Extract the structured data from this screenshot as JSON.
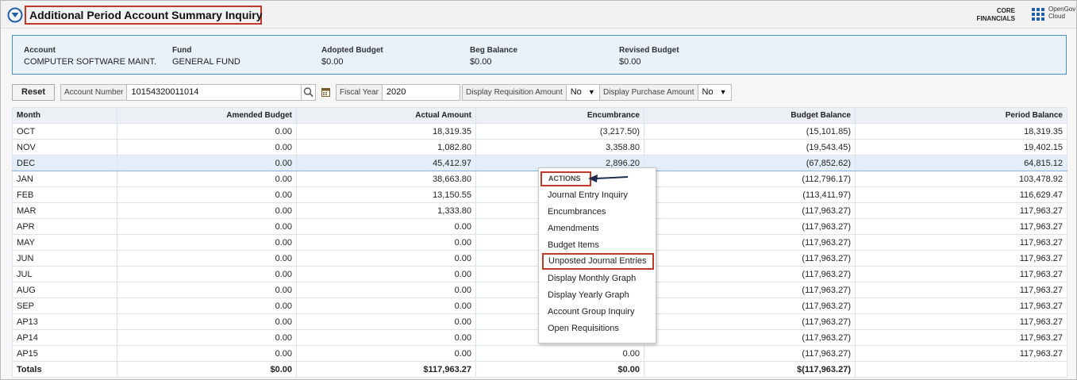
{
  "header": {
    "title": "Additional Period Account Summary Inquiry",
    "core_line1": "CORE",
    "core_line2": "FINANCIALS",
    "og_line1": "OpenGov",
    "og_line2": "Cloud"
  },
  "summary": {
    "account": {
      "label": "Account",
      "value": "COMPUTER SOFTWARE MAINT."
    },
    "fund": {
      "label": "Fund",
      "value": "GENERAL FUND"
    },
    "adopted": {
      "label": "Adopted Budget",
      "value": "$0.00"
    },
    "beg": {
      "label": "Beg Balance",
      "value": "$0.00"
    },
    "revised": {
      "label": "Revised Budget",
      "value": "$0.00"
    }
  },
  "filters": {
    "reset_label": "Reset",
    "account_number_label": "Account Number",
    "account_number_value": "10154320011014",
    "fiscal_year_label": "Fiscal Year",
    "fiscal_year_value": "2020",
    "req_label": "Display Requisition Amount",
    "req_value": "No",
    "po_label": "Display Purchase Amount",
    "po_value": "No"
  },
  "table": {
    "headers": [
      "Month",
      "Amended Budget",
      "Actual Amount",
      "Encumbrance",
      "Budget Balance",
      "Period Balance"
    ],
    "rows": [
      [
        "OCT",
        "0.00",
        "18,319.35",
        "(3,217.50)",
        "(15,101.85)",
        "18,319.35"
      ],
      [
        "NOV",
        "0.00",
        "1,082.80",
        "3,358.80",
        "(19,543.45)",
        "19,402.15"
      ],
      [
        "DEC",
        "0.00",
        "45,412.97",
        "2,896.20",
        "(67,852.62)",
        "64,815.12"
      ],
      [
        "JAN",
        "0.00",
        "38,663.80",
        "",
        "(112,796.17)",
        "103,478.92"
      ],
      [
        "FEB",
        "0.00",
        "13,150.55",
        "",
        "(113,411.97)",
        "116,629.47"
      ],
      [
        "MAR",
        "0.00",
        "1,333.80",
        "",
        "(117,963.27)",
        "117,963.27"
      ],
      [
        "APR",
        "0.00",
        "0.00",
        "",
        "(117,963.27)",
        "117,963.27"
      ],
      [
        "MAY",
        "0.00",
        "0.00",
        "",
        "(117,963.27)",
        "117,963.27"
      ],
      [
        "JUN",
        "0.00",
        "0.00",
        "",
        "(117,963.27)",
        "117,963.27"
      ],
      [
        "JUL",
        "0.00",
        "0.00",
        "",
        "(117,963.27)",
        "117,963.27"
      ],
      [
        "AUG",
        "0.00",
        "0.00",
        "",
        "(117,963.27)",
        "117,963.27"
      ],
      [
        "SEP",
        "0.00",
        "0.00",
        "",
        "(117,963.27)",
        "117,963.27"
      ],
      [
        "AP13",
        "0.00",
        "0.00",
        "",
        "(117,963.27)",
        "117,963.27"
      ],
      [
        "AP14",
        "0.00",
        "0.00",
        "",
        "(117,963.27)",
        "117,963.27"
      ],
      [
        "AP15",
        "0.00",
        "0.00",
        "0.00",
        "(117,963.27)",
        "117,963.27"
      ]
    ],
    "totals": [
      "Totals",
      "$0.00",
      "$117,963.27",
      "$0.00",
      "$(117,963.27)",
      ""
    ]
  },
  "actions_menu": {
    "header": "ACTIONS",
    "items": [
      "Journal Entry Inquiry",
      "Encumbrances",
      "Amendments",
      "Budget Items",
      "Unposted Journal Entries",
      "Display Monthly Graph",
      "Display Yearly Graph",
      "Account Group Inquiry",
      "Open Requisitions"
    ]
  },
  "colors": {
    "highlight_border": "#c0392b",
    "summary_border": "#4a90c8",
    "summary_bg": "#e9f2fb",
    "selected_row_bg": "#e4eefa",
    "brand_blue": "#1f5fa8"
  },
  "icons": [
    "filter-circle-icon",
    "apps-grid-icon",
    "search-icon",
    "calendar-icon",
    "chevron-down-icon",
    "arrow-left-icon"
  ]
}
